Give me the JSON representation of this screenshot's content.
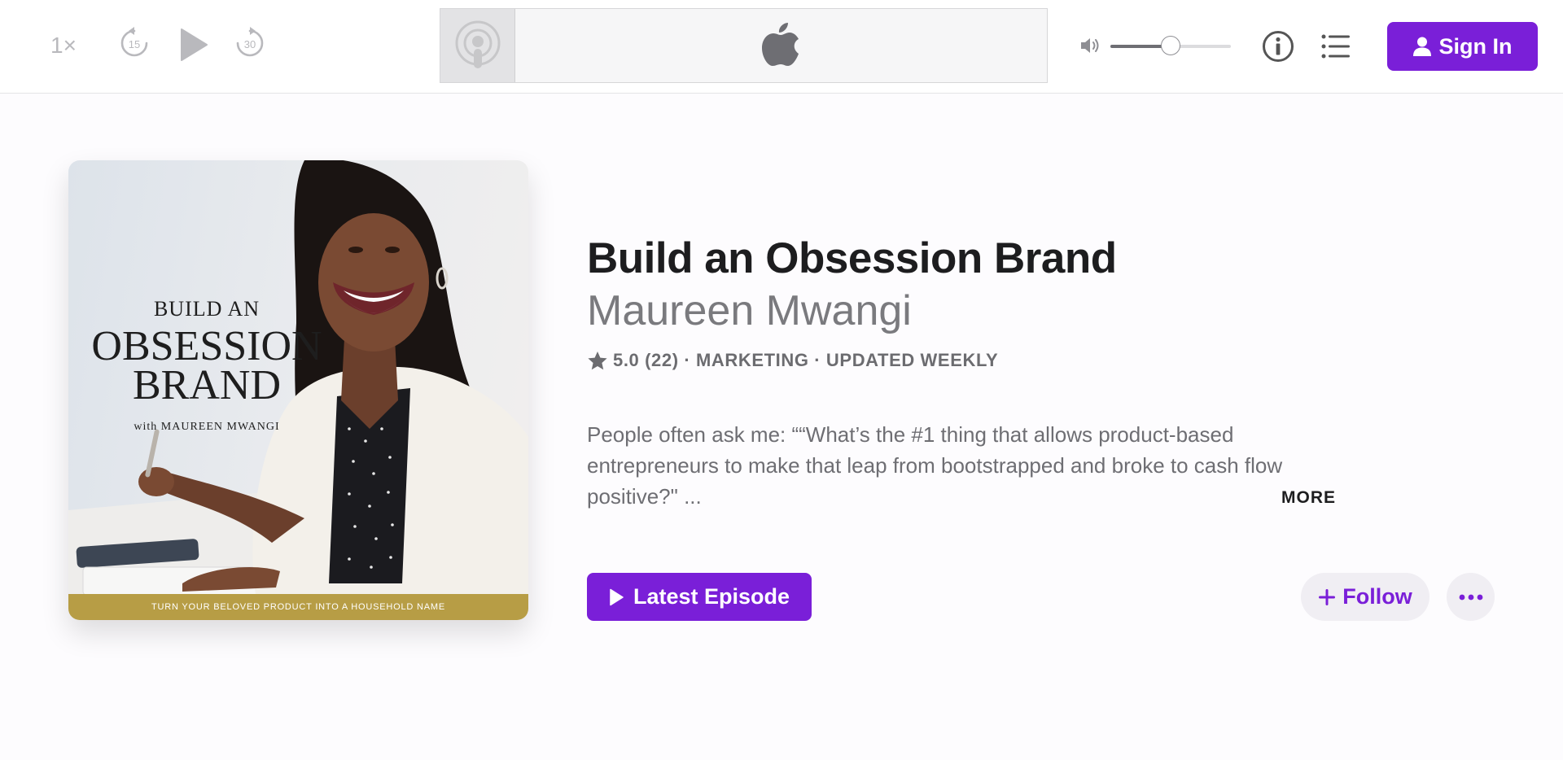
{
  "player": {
    "speed_label": "1×",
    "skip_back_seconds": "15",
    "skip_forward_seconds": "30",
    "volume_fraction": 0.5,
    "sign_in_label": "Sign In"
  },
  "podcast": {
    "artwork_text": {
      "line1": "BUILD AN",
      "line2": "OBSESSION",
      "line3": "BRAND",
      "line4": "with MAUREEN MWANGI",
      "band": "TURN YOUR BELOVED PRODUCT INTO A HOUSEHOLD NAME"
    },
    "title": "Build an Obsession Brand",
    "author": "Maureen Mwangi",
    "meta": "5.0 (22) · MARKETING · UPDATED WEEKLY",
    "description": "People often ask me: ““What’s the #1 thing that allows product-based entrepreneurs to make that leap from bootstrapped and broke to cash flow positive?\" ...",
    "more_label": "MORE",
    "latest_episode_label": "Latest Episode",
    "follow_label": "Follow"
  },
  "colors": {
    "accent": "#7a1fd8",
    "text_primary": "#1d1d1f",
    "text_secondary": "#6e6e73",
    "artwork_band": "#b79d45"
  },
  "icons": {
    "skip_back": "skip-back-15-icon",
    "play": "play-icon",
    "skip_forward": "skip-forward-30-icon",
    "podcasts": "podcasts-icon",
    "apple": "apple-logo-icon",
    "volume": "volume-icon",
    "info": "info-icon",
    "list": "list-icon",
    "user": "user-icon",
    "star": "star-icon",
    "plus": "plus-icon",
    "ellipsis": "ellipsis-icon"
  }
}
